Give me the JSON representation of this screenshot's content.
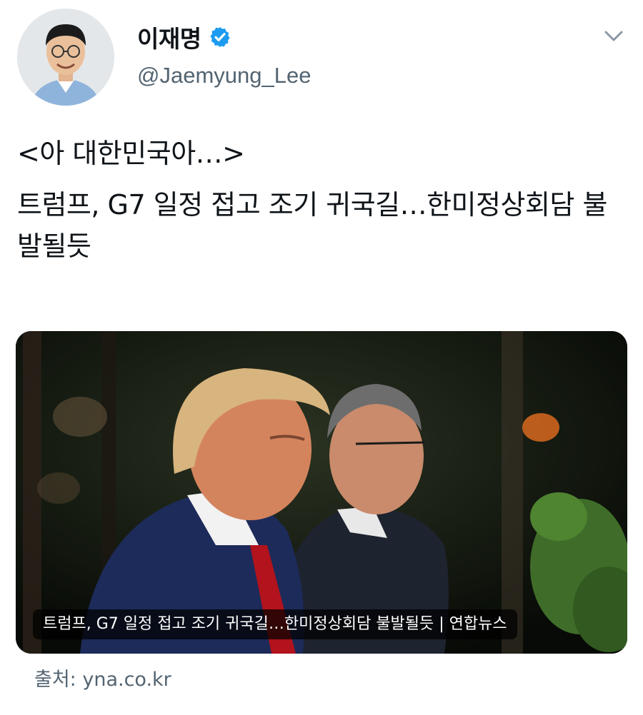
{
  "author": {
    "display_name": "이재명",
    "handle": "@Jaemyung_Lee",
    "verified": true,
    "verified_icon": "verified-badge-icon"
  },
  "menu": {
    "icon": "chevron-down-icon"
  },
  "tweet": {
    "line1": "<아 대한민국아…>",
    "headline": "트럼프, G7 일정 접고 조기 귀국길…한미정상회담 불발될듯"
  },
  "card": {
    "caption": "트럼프, G7 일정 접고 조기 귀국길…한미정상회담 불발될듯 | 연합뉴스",
    "source": "출처: yna.co.kr"
  },
  "colors": {
    "accent": "#1d9bf0",
    "secondary_text": "#536471",
    "primary_text": "#0f1419"
  }
}
